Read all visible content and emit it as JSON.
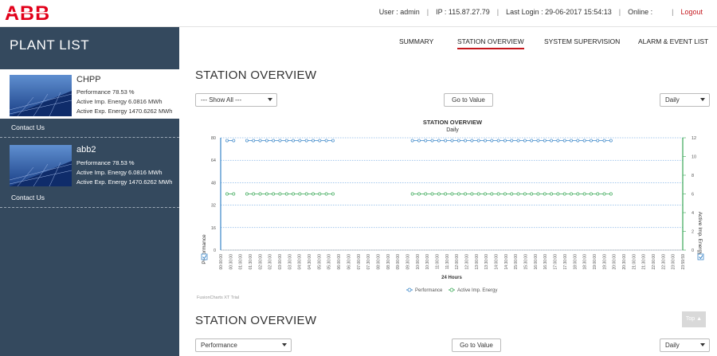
{
  "header": {
    "logo_text": "ABB",
    "user": "User : admin",
    "ip": "IP : 115.87.27.79",
    "last_login": "Last Login : 29-06-2017 15:54:13",
    "online": "Online :",
    "logout": "Logout"
  },
  "sidebar": {
    "title": "PLANT LIST",
    "plants": [
      {
        "name": "CHPP",
        "performance": "Performance 78.53 %",
        "imp_energy": "Active Imp. Energy 6.0816 MWh",
        "exp_energy": "Active Exp. Energy 1470.6262 MWh",
        "contact": "Contact Us"
      },
      {
        "name": "abb2",
        "performance": "Performance 78.53 %",
        "imp_energy": "Active Imp. Energy 6.0816 MWh",
        "exp_energy": "Active Exp. Energy 1470.6262 MWh",
        "contact": "Contact Us"
      }
    ]
  },
  "nav": {
    "tabs": [
      {
        "label": "SUMMARY"
      },
      {
        "label": "STATION OVERVIEW"
      },
      {
        "label": "SYSTEM SUPERVISION"
      },
      {
        "label": "ALARM & EVENT LIST"
      }
    ],
    "active": "STATION OVERVIEW"
  },
  "section1": {
    "title": "STATION OVERVIEW",
    "filter_value": "--- Show All ---",
    "goto_label": "Go to Value",
    "period_value": "Daily"
  },
  "section2": {
    "title": "STATION OVERVIEW",
    "filter_value": "Performance",
    "goto_label": "Go to Value",
    "period_value": "Daily",
    "top_label": "Top ▲"
  },
  "colors": {
    "sidebar": "#34495e",
    "accent_red": "#c4161c",
    "performance": "#3a86c8",
    "energy": "#3aa857"
  },
  "chart_data": {
    "type": "line",
    "title": "STATION OVERVIEW",
    "subtitle": "Daily",
    "xlabel": "24 Hours",
    "ylabel_left": "Performance",
    "ylabel_right": "Active Imp. Energy",
    "ylim_left": [
      0,
      80
    ],
    "yticks_left": [
      "0",
      "16",
      "32",
      "48",
      "64",
      "80"
    ],
    "ylim_right": [
      0,
      12
    ],
    "yticks_right": [
      "0",
      "2",
      "4",
      "6",
      "8",
      "10",
      "12"
    ],
    "grid": true,
    "legend_position": "bottom",
    "watermark": "FusionCharts XT Trial",
    "categories": [
      "00:00:00",
      "00:30:00",
      "01:00:00",
      "01:30:00",
      "02:00:00",
      "02:30:00",
      "03:00:00",
      "03:30:00",
      "04:00:00",
      "04:30:00",
      "05:00:00",
      "05:30:00",
      "06:00:00",
      "06:30:00",
      "07:00:00",
      "07:30:00",
      "08:00:00",
      "08:30:00",
      "09:00:00",
      "09:30:00",
      "10:00:00",
      "10:30:00",
      "11:00:00",
      "11:30:00",
      "12:00:00",
      "12:30:00",
      "13:00:00",
      "13:30:00",
      "14:00:00",
      "14:30:00",
      "15:00:00",
      "15:30:00",
      "16:00:00",
      "16:30:00",
      "17:00:00",
      "17:30:00",
      "18:00:00",
      "18:30:00",
      "19:00:00",
      "19:30:00",
      "20:00:00",
      "20:30:00",
      "21:00:00",
      "21:30:00",
      "22:00:00",
      "22:30:00",
      "23:00:00",
      "23:59:59"
    ],
    "series": [
      {
        "name": "Performance",
        "axis": "left",
        "values": [
          78,
          78,
          null,
          78,
          78,
          78,
          78,
          78,
          78,
          78,
          78,
          78,
          78,
          78,
          78,
          78,
          78,
          null,
          null,
          null,
          null,
          null,
          null,
          null,
          null,
          null,
          null,
          null,
          78,
          78,
          78,
          78,
          78,
          78,
          78,
          78,
          78,
          78,
          78,
          78,
          78,
          78,
          78,
          78,
          78,
          78,
          78,
          78,
          78,
          78,
          78,
          78,
          78,
          78,
          78,
          78,
          78,
          78,
          78
        ]
      },
      {
        "name": "Active Imp. Energy",
        "axis": "right",
        "values": [
          6,
          6,
          null,
          6,
          6,
          6,
          6,
          6,
          6,
          6,
          6,
          6,
          6,
          6,
          6,
          6,
          6,
          null,
          null,
          null,
          null,
          null,
          null,
          null,
          null,
          null,
          null,
          null,
          6,
          6,
          6,
          6,
          6,
          6,
          6,
          6,
          6,
          6,
          6,
          6,
          6,
          6,
          6,
          6,
          6,
          6,
          6,
          6,
          6,
          6,
          6,
          6,
          6,
          6,
          6,
          6,
          6,
          6,
          6
        ]
      }
    ]
  }
}
